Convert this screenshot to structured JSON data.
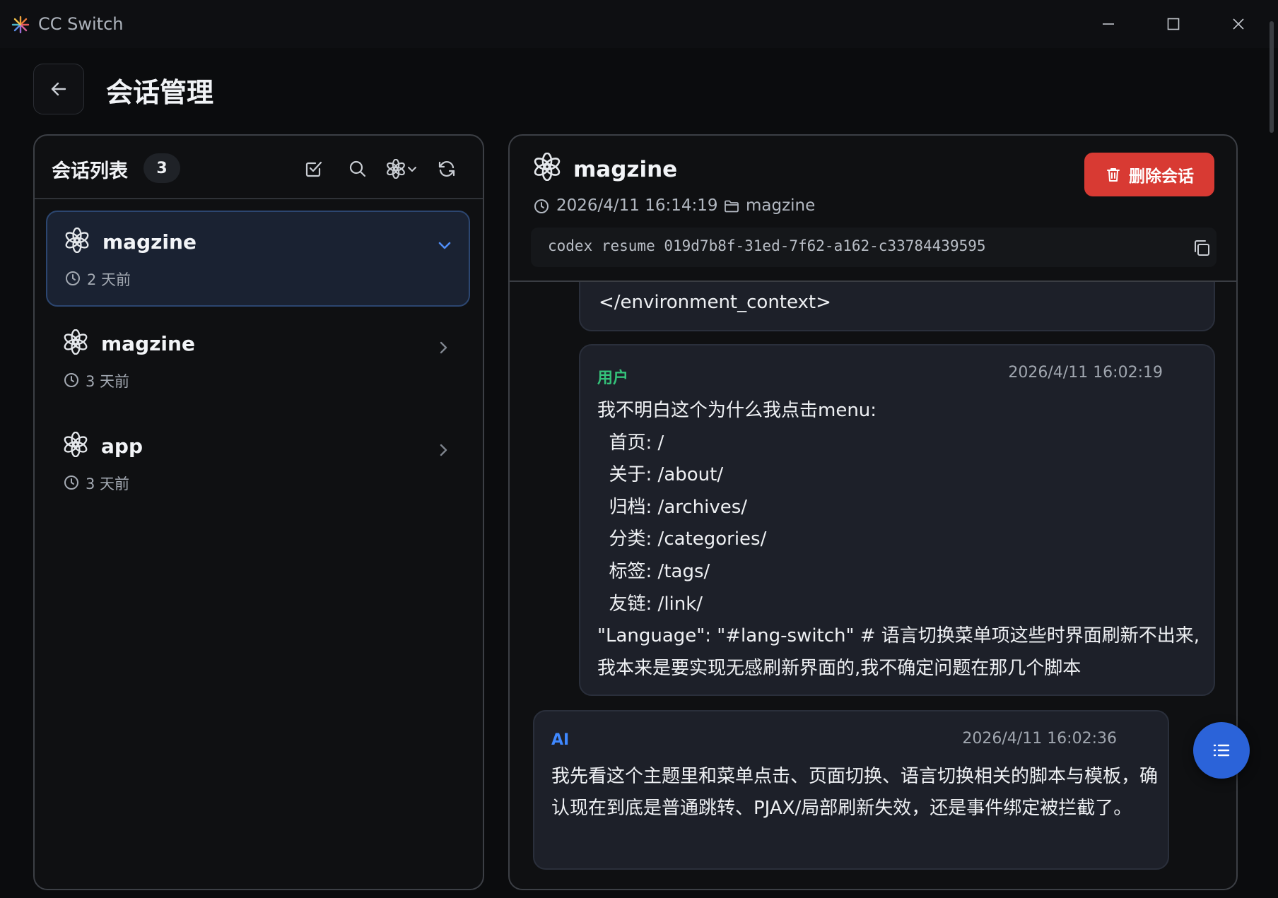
{
  "window": {
    "title": "CC Switch"
  },
  "page": {
    "title": "会话管理"
  },
  "session_list": {
    "title": "会话列表",
    "count": "3",
    "items": [
      {
        "name": "magzine",
        "time": "2 天前",
        "active": true
      },
      {
        "name": "magzine",
        "time": "3 天前",
        "active": false
      },
      {
        "name": "app",
        "time": "3 天前",
        "active": false
      }
    ]
  },
  "detail": {
    "title": "magzine",
    "timestamp": "2026/4/11 16:14:19",
    "project": "magzine",
    "delete_label": "删除会话",
    "command": "codex resume 019d7b8f-31ed-7f62-a162-c33784439595",
    "messages": {
      "prev_tail": "</environment_context>",
      "user": {
        "role": "用户",
        "time": "2026/4/11 16:02:19",
        "lines": [
          "我不明白这个为什么我点击menu:",
          "  首页: /",
          "  关于: /about/",
          "  归档: /archives/",
          "  分类: /categories/",
          "  标签: /tags/",
          "  友链: /link/",
          "  \"Language\": \"#lang-switch\" # 语言切换菜单项这些时界面刷新不出来,我本来是要实现无感刷新界面的,我不确定问题在那几个脚本"
        ]
      },
      "ai": {
        "role": "AI",
        "time": "2026/4/11 16:02:36",
        "text": "我先看这个主题里和菜单点击、页面切换、语言切换相关的脚本与模板，确认现在到底是普通跳转、PJAX/局部刷新失效，还是事件绑定被拦截了。"
      }
    }
  },
  "colors": {
    "accent_blue": "#2b63d9",
    "danger_red": "#d83a33",
    "user_green": "#34c27a",
    "ai_blue": "#3f88ff"
  },
  "icons": {
    "app_logo": "burst-logo-icon",
    "back": "arrow-left-icon",
    "session": "openai-logo-icon",
    "clock": "clock-icon",
    "folder": "folder-icon",
    "delete": "trash-icon",
    "copy": "copy-icon",
    "fab": "list-icon"
  }
}
